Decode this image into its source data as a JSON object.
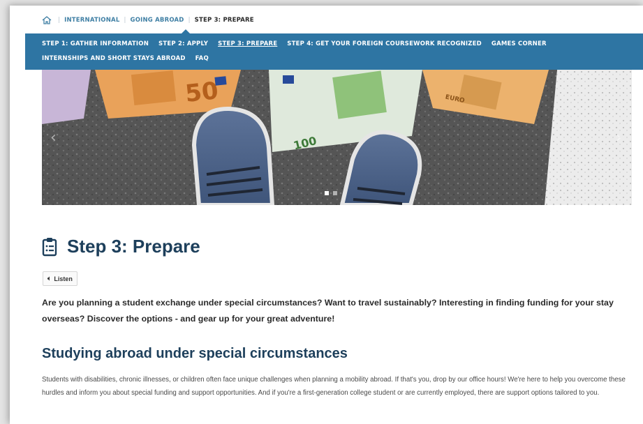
{
  "breadcrumb": {
    "home_icon": "home-icon",
    "items": [
      {
        "label": "INTERNATIONAL"
      },
      {
        "label": "GOING ABROAD"
      },
      {
        "label": "STEP 3: PREPARE"
      }
    ]
  },
  "nav": {
    "row1": [
      {
        "label": "STEP 1: GATHER INFORMATION"
      },
      {
        "label": "STEP 2: APPLY"
      },
      {
        "label": "STEP 3: PREPARE",
        "active": true
      },
      {
        "label": "STEP 4: GET YOUR FOREIGN COURSEWORK RECOGNIZED"
      },
      {
        "label": "GAMES CORNER"
      }
    ],
    "row2": [
      {
        "label": "INTERNSHIPS AND SHORT STAYS ABROAD"
      },
      {
        "label": "FAQ"
      }
    ],
    "bg_color": "#2e75a3"
  },
  "hero": {
    "slides": 2,
    "active_slide": 1,
    "note_labels": {
      "n50": "50",
      "n100": "100",
      "euro": "EURO"
    }
  },
  "main": {
    "title": "Step 3: Prepare",
    "title_icon": "clipboard-icon",
    "listen_label": "Listen",
    "listen_icon": "speaker-icon",
    "intro": "Are you planning a student exchange under special circumstances? Want to travel sustainably? Interesting in finding funding for your stay overseas? Discover the options - and gear up for your great adventure!",
    "section_heading": "Studying abroad under special circumstances",
    "section_text": "Students with disabilities, chronic illnesses, or children often face unique challenges when planning a mobility abroad. If that's you, drop by our office hours! We're here to help you overcome these hurdles and inform you about special funding and support opportunities. And if you're a first-generation college student or are currently employed, there are support options tailored to you."
  },
  "colors": {
    "heading": "#1d3f5b",
    "link": "#3f7fa4"
  }
}
